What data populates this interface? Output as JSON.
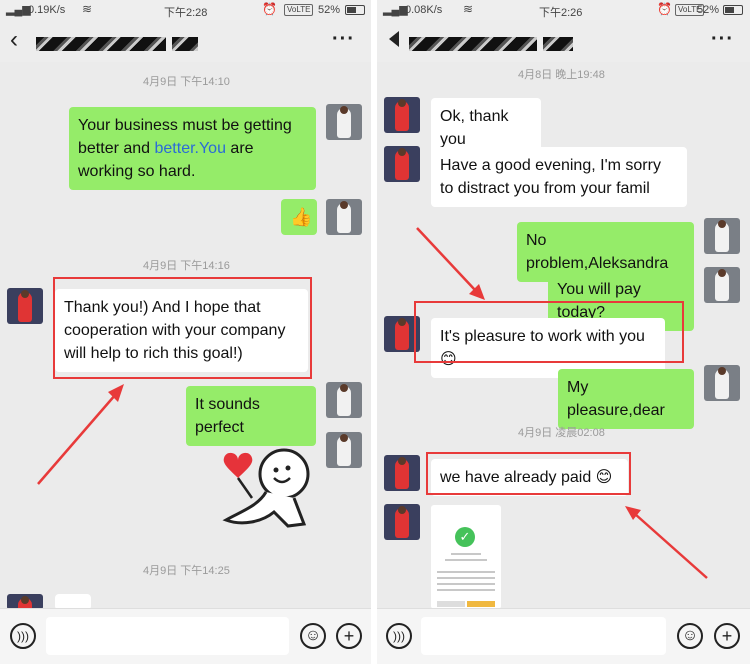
{
  "left": {
    "status": {
      "signal": "4G",
      "speed": "0.19K/s",
      "time": "下午2:28",
      "volte": "VoLTE",
      "battery": "52%"
    },
    "timestamps": [
      "4月9日 下午14:10",
      "4月9日 下午14:16",
      "4月9日 下午14:25"
    ],
    "messages": [
      {
        "from": "me",
        "text_pre": "Your business must be getting better and ",
        "text_link": "better.You",
        "text_post": " are working so hard."
      },
      {
        "from": "me",
        "type": "emoji",
        "emoji": "👍"
      },
      {
        "from": "them",
        "text": "Thank you!) And I hope that cooperation with your company will help to rich this goal!)"
      },
      {
        "from": "me",
        "text": "It sounds perfect"
      },
      {
        "from": "me",
        "type": "sticker",
        "name": "heart-sticker"
      }
    ]
  },
  "right": {
    "status": {
      "signal": "4G",
      "speed": "0.08K/s",
      "time": "下午2:26",
      "volte": "VoLTE",
      "battery": "52%"
    },
    "timestamps": [
      "4月8日 晚上19:48",
      "4月9日 凌晨02:08"
    ],
    "messages": [
      {
        "from": "them",
        "text": "Ok, thank you"
      },
      {
        "from": "them",
        "text": "Have a good evening, I'm sorry to distract you from your famil"
      },
      {
        "from": "me",
        "text": "No problem,Aleksandra"
      },
      {
        "from": "me",
        "text": "You will pay today?"
      },
      {
        "from": "them",
        "text": "It's pleasure to work with you😊"
      },
      {
        "from": "me",
        "text": "My pleasure,dear"
      },
      {
        "from": "them",
        "text": "we have already paid 😊"
      },
      {
        "from": "them",
        "type": "image",
        "name": "payment-screenshot"
      }
    ]
  },
  "icons": {
    "back": "chevron-left-icon",
    "more": "more-icon",
    "voice": "voice-icon",
    "emoji": "emoji-icon",
    "add": "add-icon",
    "arrow": "red-arrow-icon",
    "heart": "heart-icon"
  },
  "colors": {
    "my_bubble": "#95ec69",
    "their_bubble": "#ffffff",
    "chat_background": "#ebebeb",
    "highlight_box": "#e83a3a"
  }
}
